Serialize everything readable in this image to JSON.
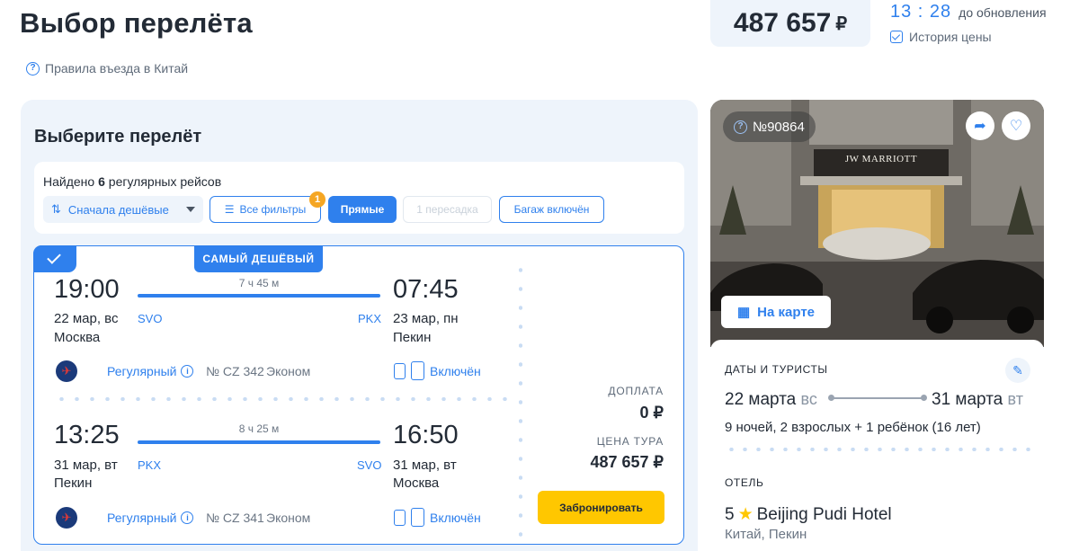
{
  "header": {
    "title": "Выбор перелёта",
    "rules_link": "Правила въезда в Китай",
    "price": "487 657",
    "price_currency": "₽",
    "timer": "13 : 28",
    "timer_label": "до обновления",
    "history_label": "История цены"
  },
  "flights_panel": {
    "title": "Выберите перелёт",
    "found_prefix": "Найдено",
    "found_count": "6",
    "found_suffix": "регулярных рейсов",
    "sort_label": "Сначала дешёвые",
    "filter_all": "Все фильтры",
    "filter_badge": "1",
    "filter_direct": "Прямые",
    "filter_one_stop": "1 пересадка",
    "filter_baggage": "Багаж включён"
  },
  "offer": {
    "badge": "САМЫЙ ДЕШЁВЫЙ",
    "outbound": {
      "dep_time": "19:00",
      "arr_time": "07:45",
      "duration": "7 ч 45 м",
      "dep_date": "22 мар, вс",
      "arr_date": "23 мар, пн",
      "dep_iata": "SVO",
      "arr_iata": "PKX",
      "dep_city": "Москва",
      "arr_city": "Пекин",
      "type": "Регулярный",
      "flight_no": "№ CZ 342",
      "cabin": "Эконом",
      "baggage": "Включён"
    },
    "inbound": {
      "dep_time": "13:25",
      "arr_time": "16:50",
      "duration": "8 ч 25 м",
      "dep_date": "31 мар, вт",
      "arr_date": "31 мар, вт",
      "dep_iata": "PKX",
      "arr_iata": "SVO",
      "dep_city": "Пекин",
      "arr_city": "Москва",
      "type": "Регулярный",
      "flight_no": "№ CZ 341",
      "cabin": "Эконом",
      "baggage": "Включён"
    },
    "surcharge_label": "ДОПЛАТА",
    "surcharge": "0 ₽",
    "tour_price_label": "ЦЕНА ТУРА",
    "tour_price": "487 657 ₽",
    "book_label": "Забронировать"
  },
  "hotel": {
    "number": "№90864",
    "sign_text": "JW MARRIOTT",
    "map_label": "На карте",
    "dates_caption": "ДАТЫ И ТУРИСТЫ",
    "date_from": "22 марта",
    "date_from_dow": "вс",
    "date_to": "31 марта",
    "date_to_dow": "вт",
    "guests": "9 ночей, 2 взрослых + 1 ребёнок (16 лет)",
    "hotel_caption": "ОТЕЛЬ",
    "stars": "5",
    "name": "Beijing Pudi Hotel",
    "country": "Китай,",
    "city": "Пекин"
  },
  "colors": {
    "accent": "#2f80ed",
    "panel_bg": "#eef4fb",
    "book_button": "#ffc700",
    "badge": "#f5a623"
  }
}
